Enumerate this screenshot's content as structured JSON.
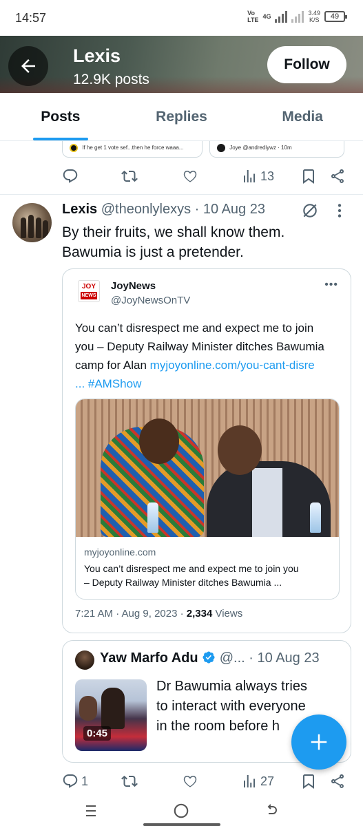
{
  "status_bar": {
    "time": "14:57",
    "network_top": "Vo",
    "network_bottom": "LTE",
    "network_type": "4G",
    "speed_value": "3.49",
    "speed_unit": "K/S",
    "battery": "49"
  },
  "header": {
    "title": "Lexis",
    "subtitle": "12.9K posts",
    "follow_label": "Follow"
  },
  "tabs": [
    {
      "label": "Posts",
      "active": true
    },
    {
      "label": "Replies",
      "active": false
    },
    {
      "label": "Media",
      "active": false
    }
  ],
  "prev_post": {
    "mini_left_text": "If he get 1 vote sef...then he force waaa...",
    "mini_right_text": "Joye @andrediywz · 10m",
    "views": "13"
  },
  "post": {
    "name": "Lexis",
    "handle": "@theonlylexys",
    "date": "· 10 Aug 23",
    "text_line1": "By their fruits, we shall know them.",
    "text_line2": "Bawumia is just a pretender.",
    "quote": {
      "logo_top": "JOY",
      "logo_bottom": "NEWS",
      "name": "JoyNews",
      "handle": "@JoyNewsOnTV",
      "more": "•••",
      "text_line1": "You can’t disrespect me and expect me to join",
      "text_line2": "you – Deputy Railway Minister ditches Bawumia",
      "text_line3_plain": "camp for Alan ",
      "text_line3_link": "myjoyonline.com/you-cant-disre",
      "text_line4_link": "... #AMShow",
      "link_domain": "myjoyonline.com",
      "link_title_line1": "You can’t disrespect me and expect me to join you",
      "link_title_line2": "– Deputy Railway Minister ditches Bawumia ...",
      "meta_time": "7:21 AM · Aug 9, 2023 · ",
      "meta_views_count": "2,334",
      "meta_views_label": " Views"
    },
    "quote2": {
      "name": "Yaw Marfo Adu",
      "handle": "@...",
      "date": "· 10 Aug 23",
      "video_duration": "0:45",
      "text_line1": "Dr Bawumia always tries",
      "text_line2": "to interact with everyone",
      "text_line3": "in the room before h"
    },
    "actions": {
      "replies": "1",
      "views": "27"
    }
  },
  "colors": {
    "accent": "#1d9bf0",
    "text_primary": "#0f1419",
    "text_secondary": "#536471",
    "border": "#cfd9de"
  }
}
